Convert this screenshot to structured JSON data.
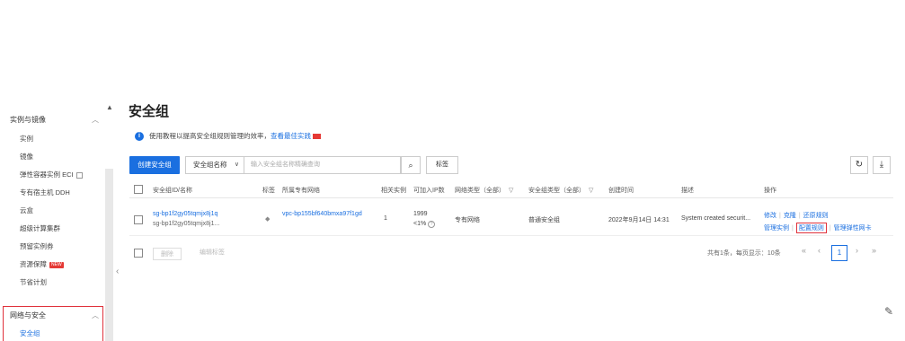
{
  "sidebar": {
    "group1": {
      "label": "实例与镜像",
      "chevron": "︿"
    },
    "items": [
      {
        "label": "实例"
      },
      {
        "label": "镜像"
      },
      {
        "label": "弹性容器实例 ECI"
      },
      {
        "label": "专有宿主机 DDH"
      },
      {
        "label": "云盒"
      },
      {
        "label": "超级计算集群"
      },
      {
        "label": "预留实例券"
      },
      {
        "label": "资源保障",
        "badge": "NEW"
      },
      {
        "label": "节省计划"
      }
    ],
    "group2": {
      "label": "网络与安全",
      "chevron": "︿"
    },
    "active_item": {
      "label": "安全组"
    },
    "scroll_up": "▲",
    "collapse_handle": "‹"
  },
  "page": {
    "title": "安全组",
    "tip_icon": "i",
    "tip_text": "使用教程以提高安全组规则管理的效率，",
    "tip_link": "查看最佳实践"
  },
  "toolbar": {
    "create_label": "创建安全组",
    "select_value": "安全组名称",
    "select_caret": "∨",
    "search_placeholder": "输入安全组名称精确查询",
    "search_icon": "⌕",
    "tag_label": "标签",
    "refresh_icon": "↻",
    "download_icon": "⤓"
  },
  "table": {
    "headers": {
      "id": "安全组ID/名称",
      "tag": "标签",
      "vpc": "所属专有网络",
      "instances": "相关实例",
      "ips": "可加入IP数",
      "net_type": "网络类型（全部）",
      "sg_type": "安全组类型（全部）",
      "created": "创建时间",
      "desc": "描述",
      "ops": "操作"
    },
    "filter_icon": "▽",
    "row": {
      "id": "sg-bp1f2gy05tqmjx8j1q",
      "name": "sg-bp1f2gy05tqmjx8j1...",
      "tag_icon": "◆",
      "vpc": "vpc-bp155bf640bmxa97f1gd",
      "instances": "1",
      "ips_total": "1999",
      "ips_usage": "<1%",
      "ips_help_icon": "?",
      "net_type": "专有网络",
      "sg_type": "普通安全组",
      "created": "2022年9月14日 14:31",
      "desc": "System created securit...",
      "op_edit": "修改",
      "op_clone": "克隆",
      "op_restore": "还原规则",
      "op_manage_instances": "管理实例",
      "op_config_rules": "配置规则",
      "op_manage_eni": "管理弹性网卡"
    }
  },
  "footer": {
    "delete_label": "删除",
    "edit_tag_label": "编辑标签",
    "pager_info": "共有1条，每页显示：10条",
    "first": "«",
    "prev": "‹",
    "current": "1",
    "next": "›",
    "last": "»"
  },
  "edit_icon": "✎"
}
